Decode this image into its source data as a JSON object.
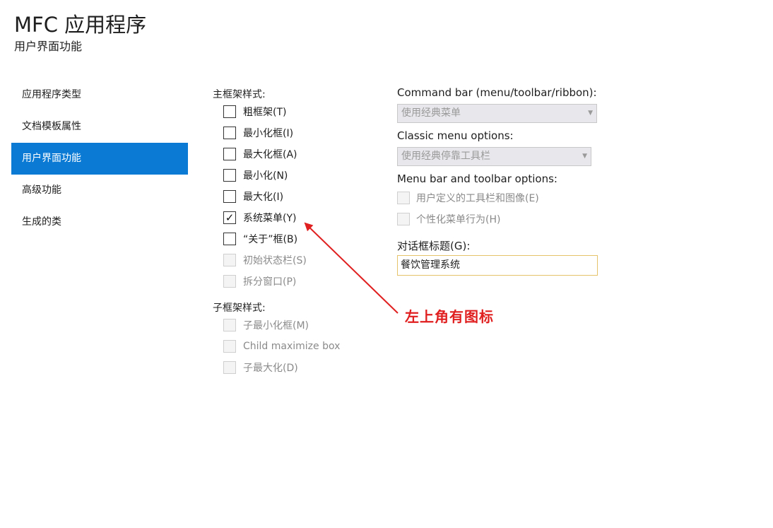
{
  "header": {
    "title": "MFC 应用程序",
    "subtitle": "用户界面功能"
  },
  "nav": {
    "items": [
      {
        "label": "应用程序类型",
        "selected": false
      },
      {
        "label": "文档模板属性",
        "selected": false
      },
      {
        "label": "用户界面功能",
        "selected": true
      },
      {
        "label": "高级功能",
        "selected": false
      },
      {
        "label": "生成的类",
        "selected": false
      }
    ]
  },
  "main_frame": {
    "label": "主框架样式:",
    "options": [
      {
        "label": "粗框架(T)",
        "checked": false,
        "enabled": true
      },
      {
        "label": "最小化框(I)",
        "checked": false,
        "enabled": true
      },
      {
        "label": "最大化框(A)",
        "checked": false,
        "enabled": true
      },
      {
        "label": "最小化(N)",
        "checked": false,
        "enabled": true
      },
      {
        "label": "最大化(I)",
        "checked": false,
        "enabled": true
      },
      {
        "label": "系统菜单(Y)",
        "checked": true,
        "enabled": true
      },
      {
        "label": "“关于”框(B)",
        "checked": false,
        "enabled": true
      },
      {
        "label": "初始状态栏(S)",
        "checked": false,
        "enabled": false
      },
      {
        "label": "拆分窗口(P)",
        "checked": false,
        "enabled": false
      }
    ]
  },
  "child_frame": {
    "label": "子框架样式:",
    "options": [
      {
        "label": "子最小化框(M)",
        "checked": false,
        "enabled": false
      },
      {
        "label": "Child maximize box",
        "checked": false,
        "enabled": false
      },
      {
        "label": "子最大化(D)",
        "checked": false,
        "enabled": false
      }
    ]
  },
  "command_bar": {
    "label": "Command bar (menu/toolbar/ribbon):",
    "value": "使用经典菜单"
  },
  "classic_menu": {
    "label": "Classic menu options:",
    "value": "使用经典停靠工具栏"
  },
  "menu_toolbar": {
    "label": "Menu bar and toolbar options:",
    "options": [
      {
        "label": "用户定义的工具栏和图像(E)",
        "checked": false,
        "enabled": false
      },
      {
        "label": "个性化菜单行为(H)",
        "checked": false,
        "enabled": false
      }
    ]
  },
  "dialog_title": {
    "label": "对话框标题(G):",
    "value": "餐饮管理系统"
  },
  "annotation": {
    "text": "左上角有图标",
    "color": "#e02020"
  },
  "colors": {
    "accent": "#0a7ad4",
    "input_border": "#e5c36b"
  },
  "icons": {
    "checkmark": "check-icon",
    "dropdown": "chevron-down-icon"
  }
}
